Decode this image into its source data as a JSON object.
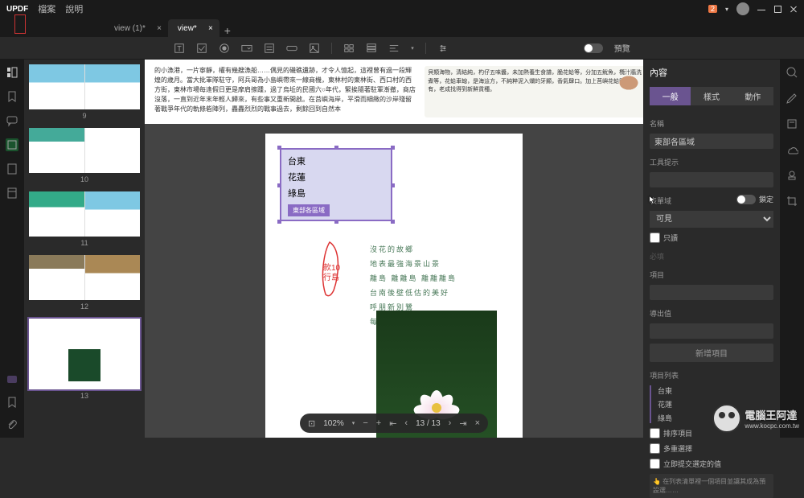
{
  "app": {
    "logo": "UPDF",
    "menu_file": "檔案",
    "menu_help": "說明",
    "badge": "2"
  },
  "tabs": {
    "t1": "view (1)*",
    "t2": "view*"
  },
  "toolbar": {
    "preview": "預覽"
  },
  "thumbs": {
    "p9": "9",
    "p10": "10",
    "p11": "11",
    "p12": "12",
    "p13": "13"
  },
  "page_top": {
    "left": "的小漁港，一片寧靜，權有幾艘漁船……偶見的磯礁遺跡，才令人憶起，這裡曾有過一段輝煌的歲月。當大批軍隊駐守，阿兵哥為小島嶼帶來一線商機，東林村的東林街、西口村的西方街，東林市場每逢假日更是摩肩擦踵，過了烏坵的民國六○年代，緊挨隨著駐軍漸撤，商店沒落，一直到近年末年輕人歸來，有些事又重新開啟。在莒嶼海岸，平滑而細緻的沙岸殘留著戰爭年代的軌條砦陣列，轟轟烈烈的戰事過去，剩餘回到自然本",
    "right": "貝類海物，清結純，杓仔五味醬，未加熱養生食譜，脆花蛤等，分加五魷魚，欖汁牆洗煮等，花蛤車螅，是海這方，不純粹泥入爛的牙顯，香氣肆口。加上莒嶼花蛤四季都有，老成找得到新鮮貨種。"
  },
  "dropdown": {
    "i1": "台東",
    "i2": "花蓮",
    "i3": "綠島",
    "selected": "東部各區域"
  },
  "red_text": {
    "a": "款10",
    "b": "行島"
  },
  "poem": {
    "l1": "沒花的故鄉",
    "l2": "地表最強海景山景",
    "l3": "離島 離離島 離離離島",
    "l4": "台南後壁低估的美好",
    "l5": "呼朋新別鷺",
    "l6": "每一季都有屬於自己的小島假期"
  },
  "zoom": {
    "pct": "102%",
    "page": "13 / 13"
  },
  "props": {
    "title": "內容",
    "tab1": "一般",
    "tab2": "樣式",
    "tab3": "動作",
    "name_label": "名稱",
    "name_value": "東部各區域",
    "tooltip_label": "工具提示",
    "formfield_label": "表單域",
    "locked": "鎖定",
    "visibility_label": "可見",
    "readonly": "只讀",
    "required": "必填",
    "item_label": "項目",
    "export_label": "導出值",
    "add_btn": "新增項目",
    "list_label": "項目列表",
    "list": {
      "i1": "台東",
      "i2": "花蓮",
      "i3": "綠島"
    },
    "sort": "排序項目",
    "multi": "多重選擇",
    "commit": "立即提交選定的值",
    "note": "在列表清單裡一個項目並讓其成為預設選……"
  },
  "watermark": {
    "title": "電腦王阿達",
    "url": "www.kocpc.com.tw"
  }
}
